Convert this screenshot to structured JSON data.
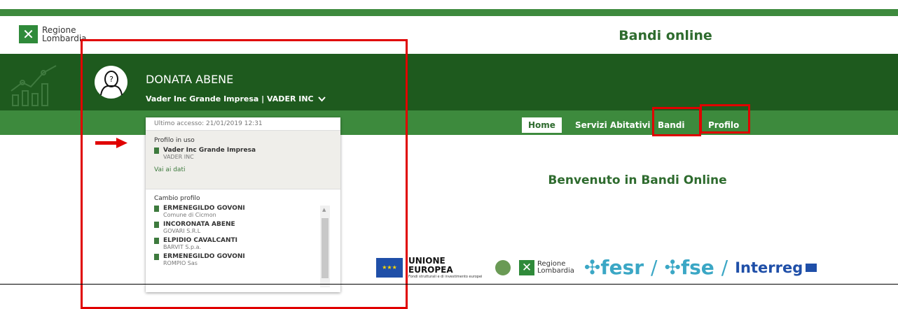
{
  "header": {
    "logo_line1": "Regione",
    "logo_line2": "Lombardia",
    "site_title": "Bandi online"
  },
  "user": {
    "name": "DONATA ABENE",
    "company": "Vader Inc Grande Impresa | VADER INC"
  },
  "nav": {
    "items": [
      {
        "label": "Home"
      },
      {
        "label": "Servizi Abitativi"
      },
      {
        "label": "Bandi"
      },
      {
        "label": "Profilo"
      }
    ]
  },
  "welcome": "Benvenuto in Bandi Online",
  "profile_panel": {
    "last_access": "Ultimo accesso: 21/01/2019 12:31",
    "in_use_label": "Profilo in uso",
    "in_use": {
      "name": "Vader Inc Grande Impresa",
      "sub": "VADER INC"
    },
    "go_to_data": "Vai ai dati",
    "switch_label": "Cambio profilo",
    "profiles": [
      {
        "name": "ERMENEGILDO GOVONI",
        "sub": "Comune di Cicmon"
      },
      {
        "name": "INCORONATA ABENE",
        "sub": "GOVARI S.R.L"
      },
      {
        "name": "ELPIDIO CAVALCANTI",
        "sub": "BARVIT S.p.a."
      },
      {
        "name": "ERMENEGILDO GOVONI",
        "sub": "ROMPIO Sas"
      }
    ]
  },
  "footer": {
    "eu_title": "UNIONE EUROPEA",
    "eu_subtitle": "Fondi strutturali e di investimento europei",
    "logo_line1": "Regione",
    "logo_line2": "Lombardia",
    "fesr": "fesr",
    "fse": "fse",
    "interreg": "Interreg"
  },
  "colors": {
    "dark_green": "#1e5a1e",
    "green": "#3d8a3d",
    "title_green": "#2e6b2e",
    "highlight_red": "#e00000"
  }
}
